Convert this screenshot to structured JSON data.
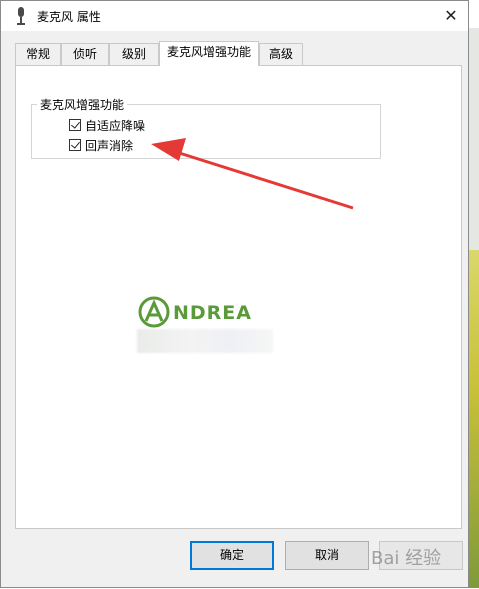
{
  "window": {
    "title": "麦克风 属性",
    "close_glyph": "✕"
  },
  "tabs": [
    {
      "label": "常规",
      "active": false
    },
    {
      "label": "侦听",
      "active": false
    },
    {
      "label": "级别",
      "active": false
    },
    {
      "label": "麦克风增强功能",
      "active": true
    },
    {
      "label": "高级",
      "active": false
    }
  ],
  "group": {
    "title": "麦克风增强功能",
    "options": [
      {
        "label": "自适应降噪",
        "checked": true
      },
      {
        "label": "回声消除",
        "checked": true
      }
    ]
  },
  "logo": {
    "text": "NDREA",
    "color": "#5a9a3a"
  },
  "buttons": {
    "ok": "确定",
    "cancel": "取消"
  },
  "watermark": {
    "text": "Bai 经验"
  },
  "annotation": {
    "arrow_color": "#e53935"
  }
}
